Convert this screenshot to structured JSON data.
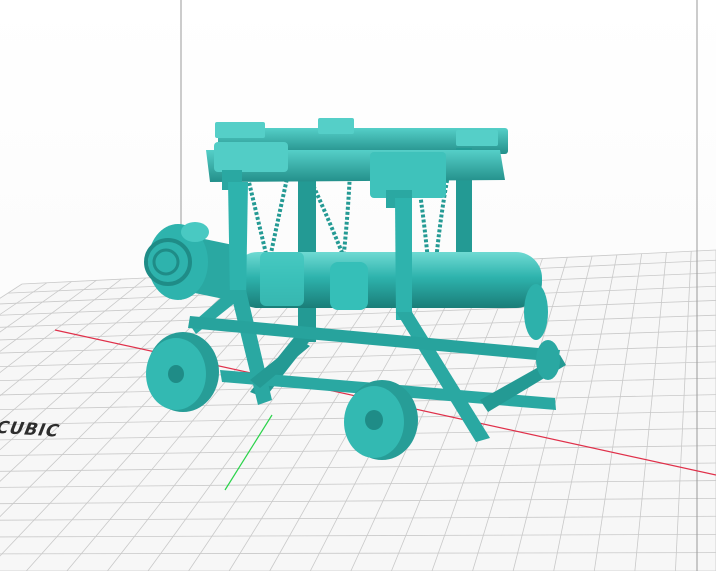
{
  "viewport": {
    "title": "",
    "build_plate_label": "CUBIC",
    "background_color": "#ffffff",
    "grid_color": "#c9c9c9",
    "x_axis_color": "#e0304a",
    "y_axis_color": "#2bd34b",
    "z_axis_color": "#9a9a9a"
  },
  "model": {
    "name": "",
    "color": "#2eb3ad",
    "shadow_color": "#1a7d78",
    "highlight_color": "#6fdad3",
    "icon": "siege-cannon-model-icon"
  }
}
